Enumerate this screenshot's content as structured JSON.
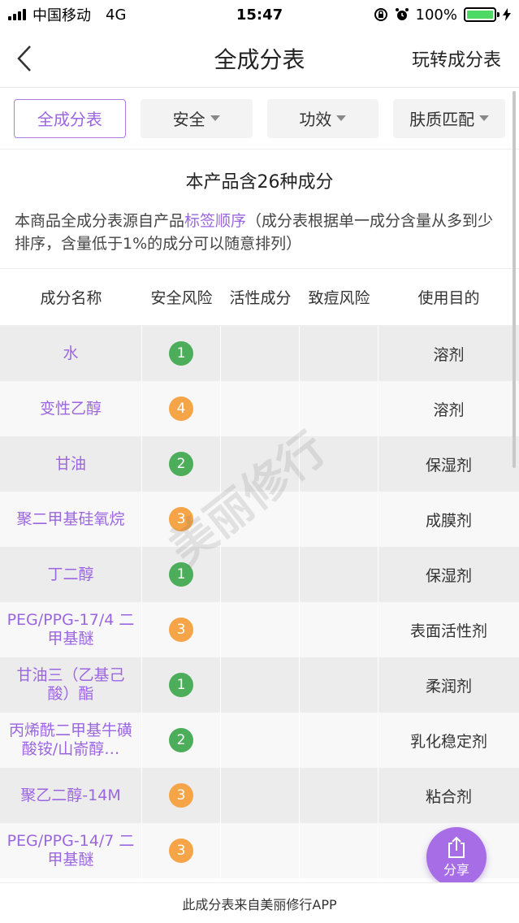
{
  "status_bar": {
    "carrier": "中国移动",
    "network": "4G",
    "time": "15:47",
    "battery": "100%"
  },
  "nav": {
    "title": "全成分表",
    "right_link": "玩转成分表"
  },
  "filters": [
    {
      "label": "全成分表",
      "active": true
    },
    {
      "label": "安全",
      "active": false
    },
    {
      "label": "功效",
      "active": false
    },
    {
      "label": "肤质匹配",
      "active": false
    }
  ],
  "summary": {
    "title": "本产品含26种成分",
    "desc_prefix": "本商品全成分表源自产品",
    "desc_highlight": "标签顺序",
    "desc_suffix": "（成分表根据单一成分含量从多到少排序，含量低于1%的成分可以随意排列）"
  },
  "columns": [
    "成分名称",
    "安全风险",
    "活性成分",
    "致痘风险",
    "使用目的"
  ],
  "colors": {
    "accent": "#9b66e0",
    "safe_green": "#4cae5b",
    "warn_orange": "#f5a547"
  },
  "rows": [
    {
      "name": "水",
      "risk": "1",
      "level": "green",
      "use": "溶剂"
    },
    {
      "name": "变性乙醇",
      "risk": "4",
      "level": "orange",
      "use": "溶剂"
    },
    {
      "name": "甘油",
      "risk": "2",
      "level": "green",
      "use": "保湿剂"
    },
    {
      "name": "聚二甲基硅氧烷",
      "risk": "3",
      "level": "orange",
      "use": "成膜剂"
    },
    {
      "name": "丁二醇",
      "risk": "1",
      "level": "green",
      "use": "保湿剂"
    },
    {
      "name": "PEG/PPG-17/4 二甲基醚",
      "risk": "3",
      "level": "orange",
      "use": "表面活性剂"
    },
    {
      "name": "甘油三（乙基己酸）酯",
      "risk": "1",
      "level": "green",
      "use": "柔润剂"
    },
    {
      "name": "丙烯酰二甲基牛磺酸铵/山嵛醇…",
      "risk": "2",
      "level": "green",
      "use": "乳化稳定剂"
    },
    {
      "name": "聚乙二醇-14M",
      "risk": "3",
      "level": "orange",
      "use": "粘合剂"
    },
    {
      "name": "PEG/PPG-14/7 二甲基醚",
      "risk": "3",
      "level": "orange",
      "use": ""
    }
  ],
  "share": {
    "label": "分享"
  },
  "footer": {
    "text": "此成分表来自美丽修行APP"
  },
  "watermark": "美丽修行"
}
